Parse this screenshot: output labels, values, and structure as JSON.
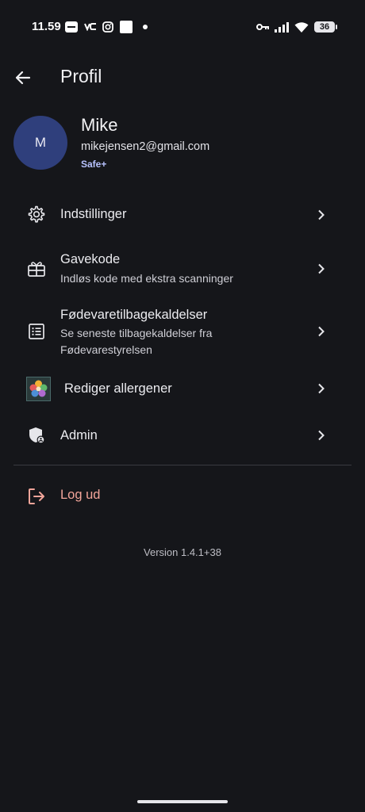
{
  "status": {
    "time": "11.59",
    "battery": "36",
    "icons": [
      "fiskeringen-app-icon",
      "vc-app-icon",
      "instagram-icon",
      "square-app-icon",
      "notification-dot",
      "key-icon",
      "signal-icon",
      "wifi-icon",
      "battery-icon"
    ]
  },
  "appbar": {
    "title": "Profil",
    "back_icon": "arrow-back-icon"
  },
  "profile": {
    "avatar_initial": "M",
    "name": "Mike",
    "email": "mikejensen2@gmail.com",
    "tier": "Safe+"
  },
  "menu": [
    {
      "label": "Indstillinger",
      "subtitle": "",
      "icon": "gear-icon"
    },
    {
      "label": "Gavekode",
      "subtitle": "Indløs kode med ekstra scanninger",
      "icon": "gift-icon"
    },
    {
      "label": "Fødevaretilbagekaldelser",
      "subtitle": "Se seneste tilbagekaldelser fra Fødevarestyrelsen",
      "icon": "list-icon"
    },
    {
      "label": "Rediger allergener",
      "subtitle": "",
      "icon": "allergen-flower-icon"
    },
    {
      "label": "Admin",
      "subtitle": "",
      "icon": "admin-shield-icon"
    }
  ],
  "logout": {
    "label": "Log ud",
    "icon": "logout-icon"
  },
  "version": "Version 1.4.1+38",
  "colors": {
    "background": "#15161a",
    "avatar": "#2f3f7c",
    "tier": "#b8c3ff",
    "logout": "#f2a59a"
  }
}
